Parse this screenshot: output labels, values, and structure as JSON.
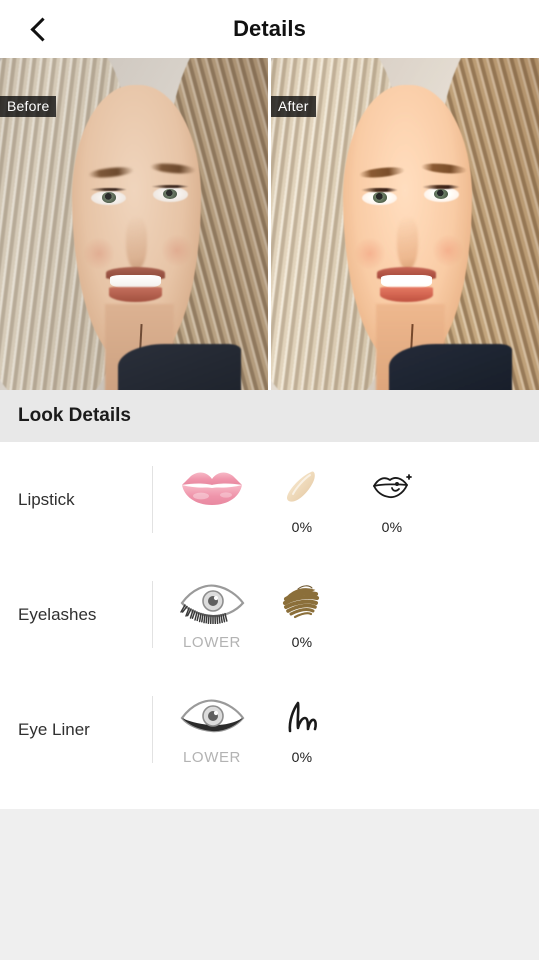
{
  "header": {
    "back_icon": "chevron-left-icon",
    "title": "Details"
  },
  "compare": {
    "before_label": "Before",
    "after_label": "After"
  },
  "section": {
    "title": "Look Details"
  },
  "rows": [
    {
      "label": "Lipstick",
      "items": [
        {
          "icon": "lips-icon",
          "caption": ""
        },
        {
          "icon": "lip-gloss-swatch-icon",
          "caption": "0%"
        },
        {
          "icon": "lip-outline-icon",
          "caption": "0%"
        }
      ]
    },
    {
      "label": "Eyelashes",
      "items": [
        {
          "icon": "eyelash-eye-icon",
          "caption": "LOWER"
        },
        {
          "icon": "brown-brush-swatch-icon",
          "caption": "0%"
        }
      ]
    },
    {
      "label": "Eye Liner",
      "items": [
        {
          "icon": "eyeliner-eye-icon",
          "caption": "LOWER"
        },
        {
          "icon": "eyeliner-stroke-icon",
          "caption": "0%"
        }
      ]
    }
  ],
  "colors": {
    "background": "#efefef",
    "card": "#ffffff",
    "section_bar": "#e8e8e8",
    "text": "#1d1d1d",
    "muted_text": "#b3b3b3",
    "lips_pink": "#f2a3b4",
    "gloss_cream": "#f3dfc4",
    "brush_brown": "#8b6f3a",
    "liner_black": "#1a1a1a"
  }
}
